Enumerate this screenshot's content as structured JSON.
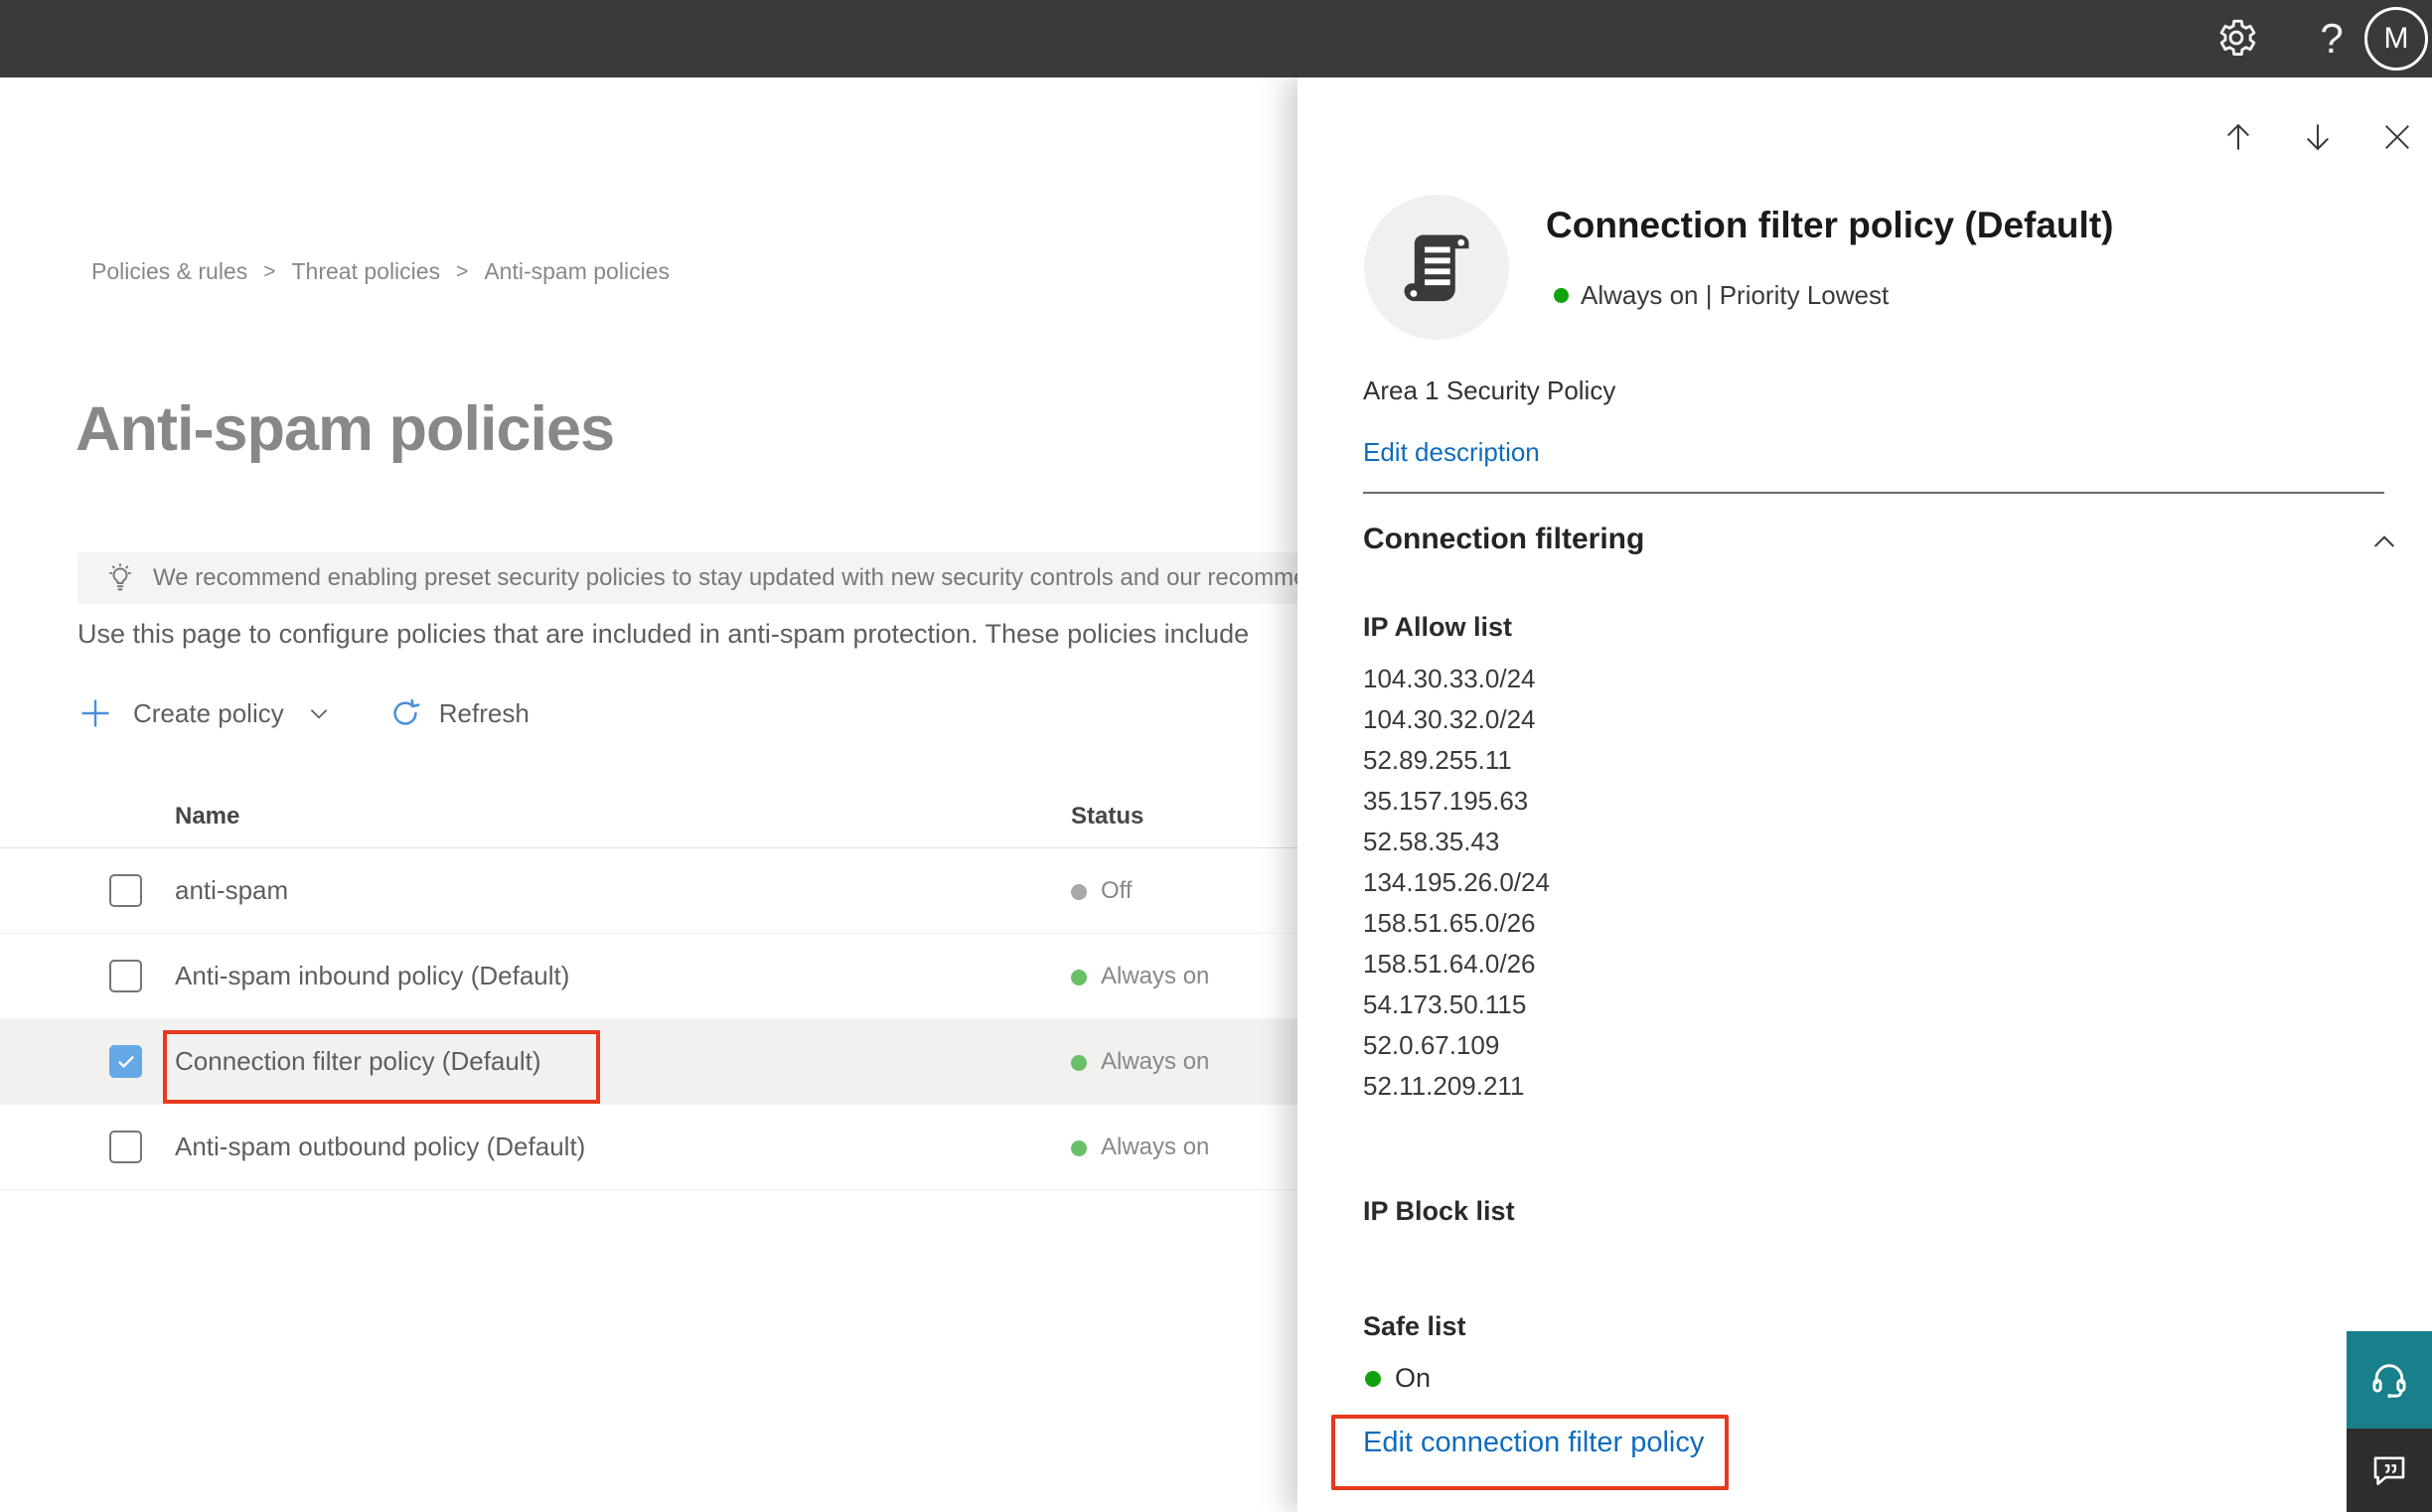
{
  "topbar": {
    "help_label": "?",
    "avatar_initial": "M"
  },
  "breadcrumb": {
    "separator": ">",
    "items": [
      {
        "label": "Policies & rules"
      },
      {
        "label": "Threat policies"
      },
      {
        "label": "Anti-spam policies"
      }
    ]
  },
  "page": {
    "title": "Anti-spam policies",
    "banner_text": "We recommend enabling preset security policies to stay updated with new security controls and our recomme",
    "description": "Use this page to configure policies that are included in anti-spam protection. These policies include",
    "toolbar": {
      "create_policy_label": "Create policy",
      "refresh_label": "Refresh"
    }
  },
  "table": {
    "columns": {
      "name": "Name",
      "status": "Status"
    },
    "rows": [
      {
        "name": "anti-spam",
        "status": "Off"
      },
      {
        "name": "Anti-spam inbound policy (Default)",
        "status": "Always on"
      },
      {
        "name": "Connection filter policy (Default)",
        "status": "Always on"
      },
      {
        "name": "Anti-spam outbound policy (Default)",
        "status": "Always on"
      }
    ]
  },
  "flyout": {
    "title": "Connection filter policy (Default)",
    "status_line": "Always on | Priority Lowest",
    "description": "Area 1 Security Policy",
    "edit_description_label": "Edit description",
    "section_title": "Connection filtering",
    "ip_allow_label": "IP Allow list",
    "ip_allow_list": [
      "104.30.33.0/24",
      "104.30.32.0/24",
      "52.89.255.11",
      "35.157.195.63",
      "52.58.35.43",
      "134.195.26.0/24",
      "158.51.65.0/26",
      "158.51.64.0/26",
      "54.173.50.115",
      "52.0.67.109",
      "52.11.209.211"
    ],
    "ip_block_label": "IP Block list",
    "safe_list_label": "Safe list",
    "safe_list_status": "On",
    "edit_link_label": "Edit connection filter policy"
  },
  "colors": {
    "topbar_bg": "#3a3a38",
    "accent_blue": "#4a90d9",
    "link_blue": "#0f6cbd",
    "checkbox_blue": "#65a8e6",
    "status_on_green": "#6abf69",
    "panel_green": "#11a10d",
    "status_off_gray": "#a8a8a8",
    "annotation_red": "#e8391f",
    "selected_row_bg": "#f2f1f0",
    "support_teal": "#17808a",
    "chat_dark": "#2f2e2d"
  }
}
